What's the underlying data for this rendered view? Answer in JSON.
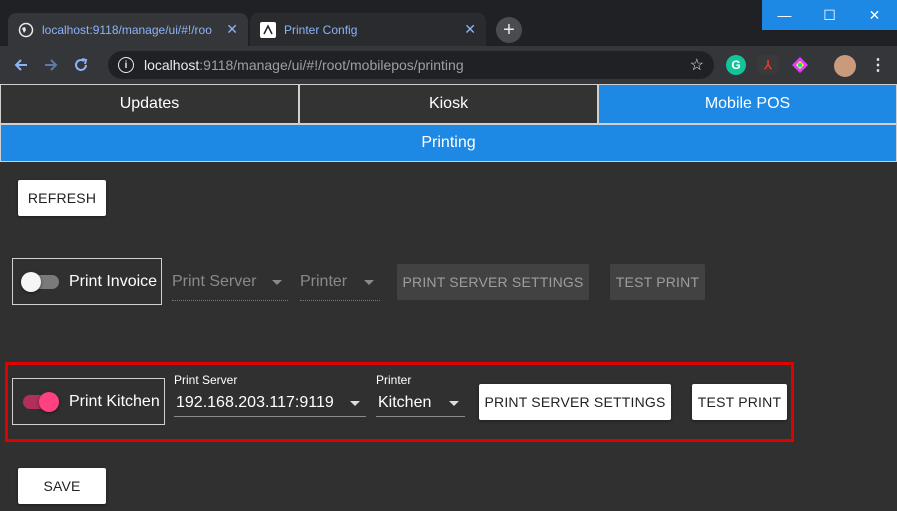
{
  "browser": {
    "tabs": [
      {
        "title": "localhost:9118/manage/ui/#!/roo",
        "active": true
      },
      {
        "title": "Printer Config",
        "active": false
      }
    ],
    "url_host": "localhost",
    "url_path": ":9118/manage/ui/#!/root/mobilepos/printing",
    "window_controls": {
      "minimize": "—",
      "maximize": "☐",
      "close": "✕"
    }
  },
  "nav": {
    "tabs": [
      {
        "label": "Updates",
        "active": false
      },
      {
        "label": "Kiosk",
        "active": false
      },
      {
        "label": "Mobile POS",
        "active": true
      }
    ],
    "subtab": "Printing"
  },
  "actions": {
    "refresh": "REFRESH",
    "save": "SAVE"
  },
  "invoice": {
    "toggle_label": "Print Invoice",
    "enabled": false,
    "server_placeholder": "Print Server",
    "printer_placeholder": "Printer",
    "settings_button": "PRINT SERVER SETTINGS",
    "test_button": "TEST PRINT"
  },
  "kitchen": {
    "toggle_label": "Print Kitchen",
    "enabled": true,
    "server_label": "Print Server",
    "server_value": "192.168.203.117:9119",
    "printer_label": "Printer",
    "printer_value": "Kitchen",
    "settings_button": "PRINT SERVER SETTINGS",
    "test_button": "TEST PRINT"
  },
  "colors": {
    "accent": "#1e88e5",
    "toggle_on": "#ff4081",
    "highlight": "#e00000"
  }
}
